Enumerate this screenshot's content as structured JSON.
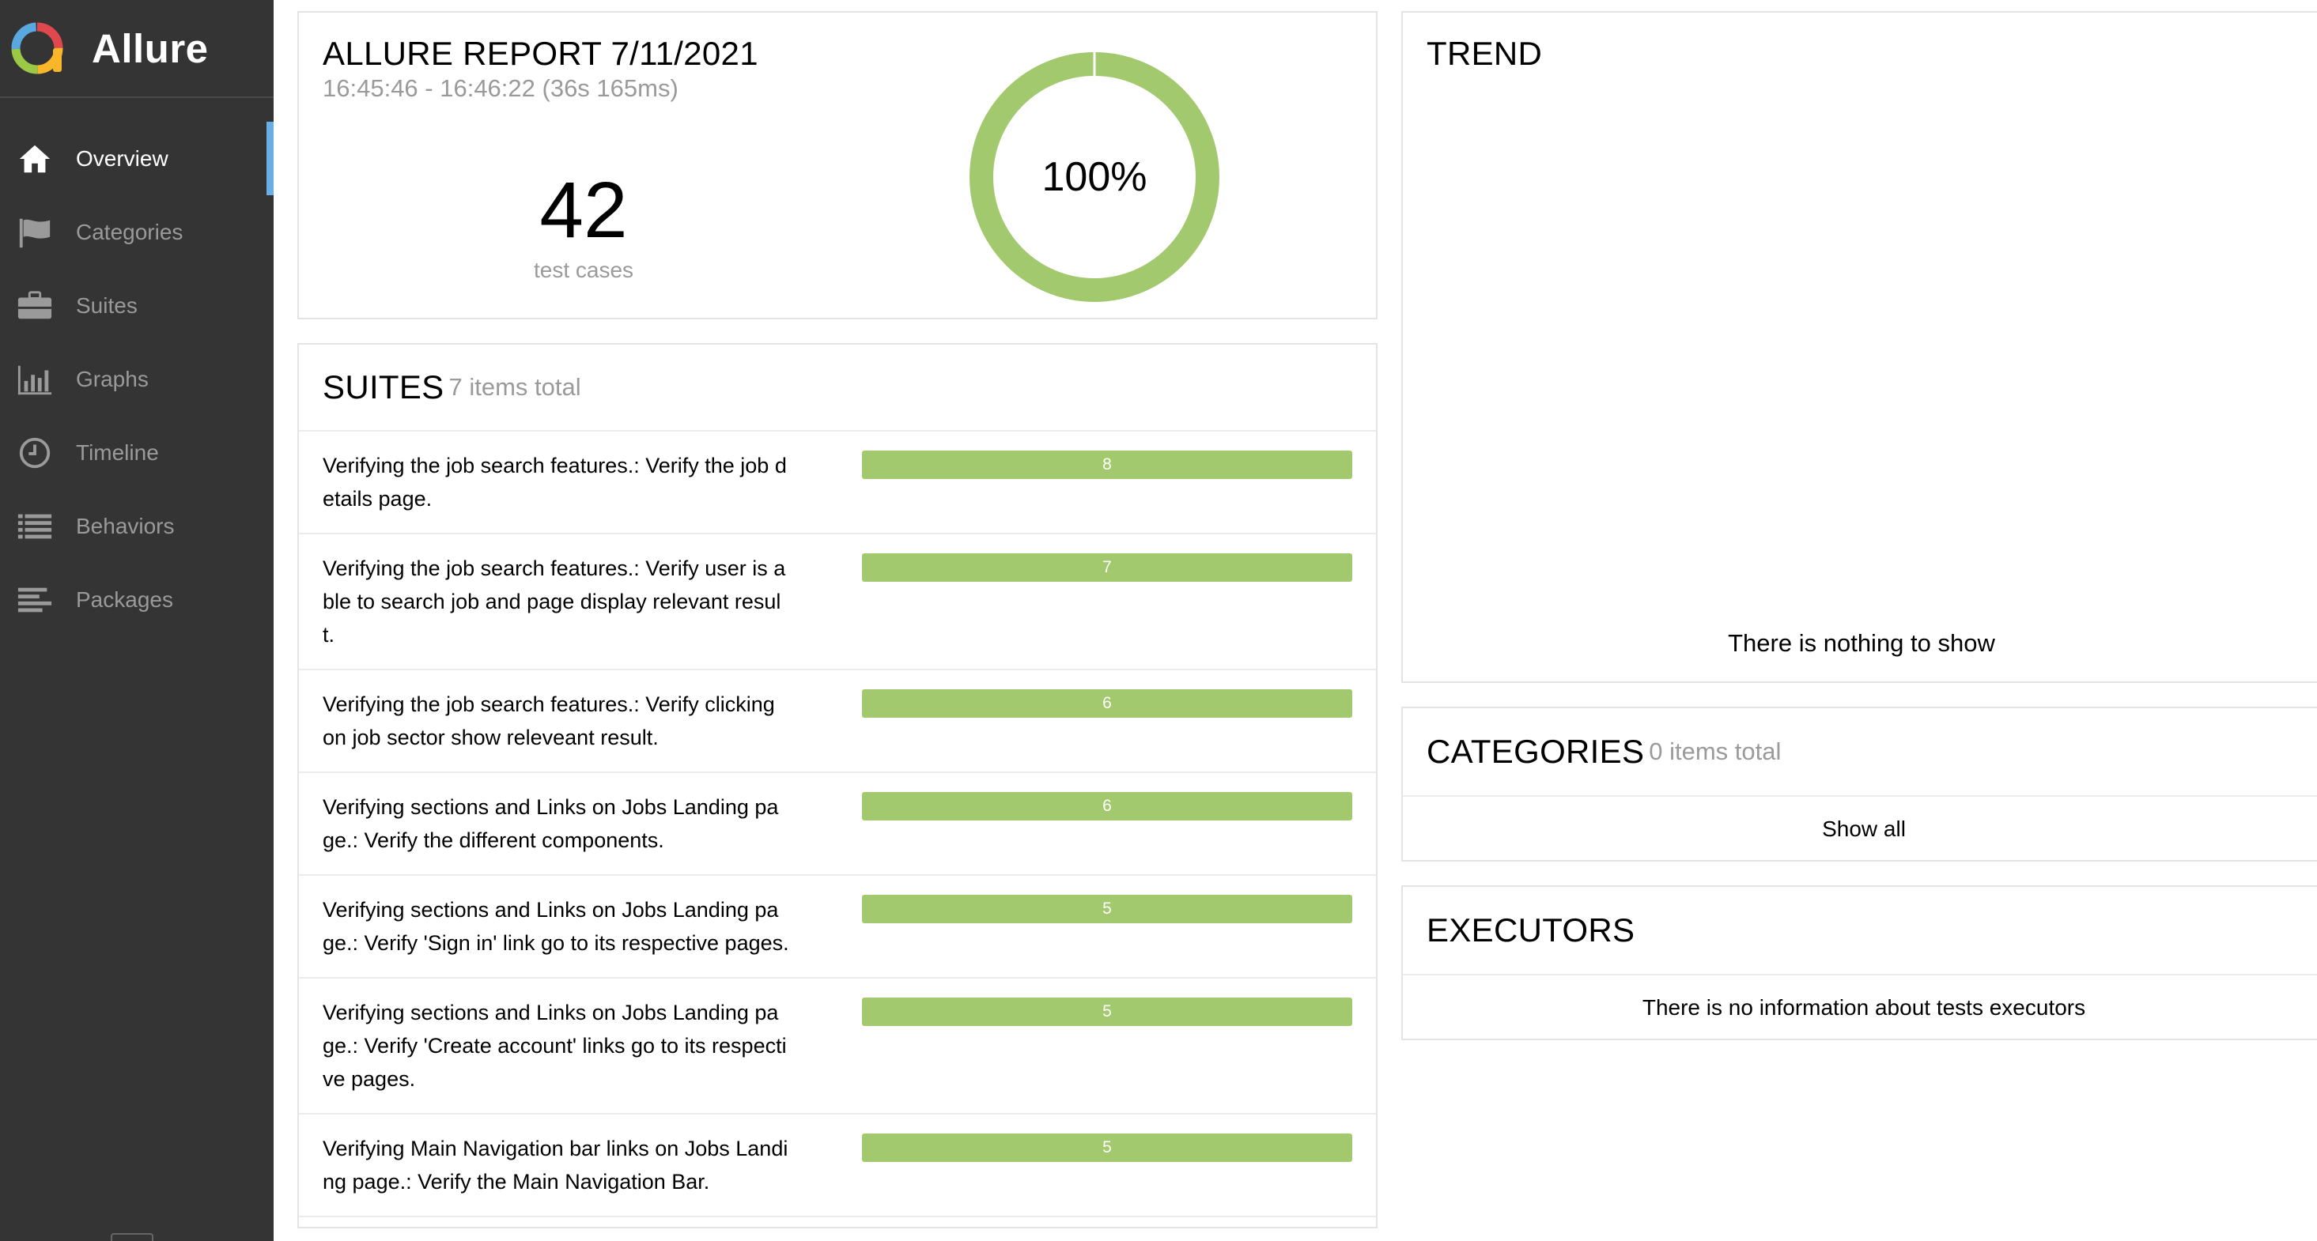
{
  "brand": {
    "name": "Allure"
  },
  "sidebar": {
    "items": [
      {
        "label": "Overview",
        "icon": "home-icon",
        "active": true
      },
      {
        "label": "Categories",
        "icon": "flag-icon",
        "active": false
      },
      {
        "label": "Suites",
        "icon": "briefcase-icon",
        "active": false
      },
      {
        "label": "Graphs",
        "icon": "bar-chart-icon",
        "active": false
      },
      {
        "label": "Timeline",
        "icon": "clock-icon",
        "active": false
      },
      {
        "label": "Behaviors",
        "icon": "list-icon",
        "active": false
      },
      {
        "label": "Packages",
        "icon": "align-left-icon",
        "active": false
      }
    ]
  },
  "summary": {
    "title": "ALLURE REPORT 7/11/2021",
    "time": "16:45:46 - 16:46:22 (36s 165ms)",
    "count": "42",
    "count_label": "test cases",
    "percent_label": "100%",
    "passed_fraction": 1.0
  },
  "suites": {
    "title": "SUITES",
    "subtitle": "7 items total",
    "rows": [
      {
        "name": "Verifying the job search features.: Verify the job details page.",
        "count": "8"
      },
      {
        "name": "Verifying the job search features.: Verify user is able to search job and page display relevant result.",
        "count": "7"
      },
      {
        "name": "Verifying the job search features.: Verify clicking on job sector show releveant result.",
        "count": "6"
      },
      {
        "name": "Verifying sections and Links on Jobs Landing page.: Verify the different components.",
        "count": "6"
      },
      {
        "name": "Verifying sections and Links on Jobs Landing page.: Verify 'Sign in' link go to its respective pages.",
        "count": "5"
      },
      {
        "name": "Verifying sections and Links on Jobs Landing page.: Verify 'Create account' links go to its respective pages.",
        "count": "5"
      },
      {
        "name": "Verifying Main Navigation bar links on Jobs Landing page.: Verify the Main Navigation Bar.",
        "count": "5"
      }
    ],
    "show_all": "Show all"
  },
  "trend": {
    "title": "TREND",
    "empty": "There is nothing to show"
  },
  "categories": {
    "title": "CATEGORIES",
    "subtitle": "0 items total",
    "show_all": "Show all"
  },
  "executors": {
    "title": "EXECUTORS",
    "empty": "There is no information about tests executors"
  },
  "colors": {
    "sidebar_bg": "#343434",
    "active_marker": "#6aaee6",
    "passed": "#a3c96f"
  }
}
